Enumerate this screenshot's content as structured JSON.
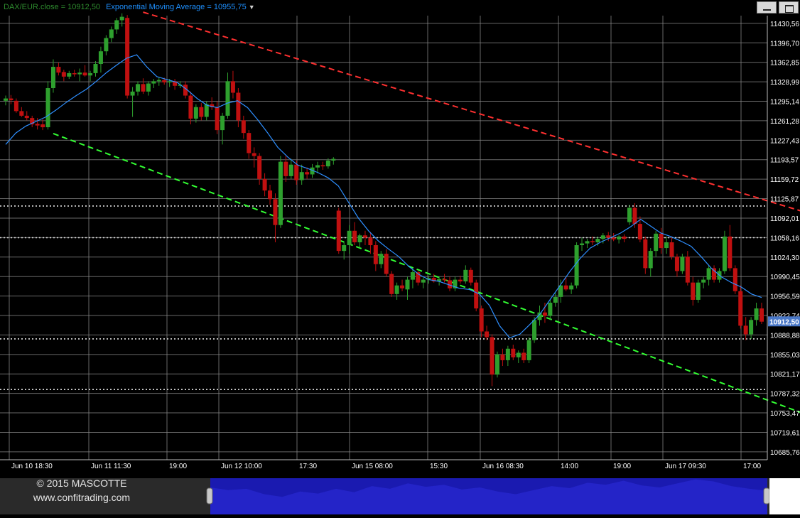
{
  "legend": {
    "close_label": "DAX/EUR.close = 10912,50",
    "ema_label": "Exponential Moving Average = 10955,75"
  },
  "footer": {
    "copyright": "© 2015 MASCOTTE",
    "website": "www.confitrading.com"
  },
  "colors": {
    "up_candle": "#2ea02e",
    "down_candle": "#c01010",
    "ema_line": "#2e8fff",
    "resistance_line": "#ff3030",
    "support_line": "#33ff33",
    "grid": "#8a8a8a",
    "navigator_fill": "#2424c8",
    "navigator_bg": "#1a1ab0"
  },
  "chart_data": {
    "type": "candlestick",
    "y_ticks": [
      "11430,56",
      "11396,70",
      "11362,85",
      "11328,99",
      "11295,14",
      "11261,28",
      "11227,43",
      "11193,57",
      "11159,72",
      "11125,87",
      "11092,01",
      "11058,16",
      "11024,30",
      "10990,45",
      "10956,59",
      "10922,74",
      "10888,88",
      "10855,03",
      "10821,17",
      "10787,32",
      "10753,47",
      "10719,61",
      "10685,76"
    ],
    "y_range": [
      10672,
      11444
    ],
    "x_ticks": [
      "Jun 10 18:30",
      "Jun 11 11:30",
      "19:00",
      "Jun 12 10:00",
      "17:30",
      "Jun 15 08:00",
      "15:30",
      "Jun 16 08:30",
      "14:00",
      "19:00",
      "Jun 17 09:30",
      "17:00"
    ],
    "last_price_label": "10912,50",
    "last_price": 10912.5,
    "horizontal_levels": [
      11113,
      11058,
      10882,
      10794
    ],
    "trendlines": [
      {
        "kind": "resistance",
        "from": [
          26,
          11450
        ],
        "to": [
          178,
          11028
        ]
      },
      {
        "kind": "support",
        "from": [
          9,
          11239
        ],
        "to": [
          172,
          10680
        ]
      }
    ],
    "candles": [
      {
        "o": 11296,
        "h": 11305,
        "l": 11288,
        "c": 11300
      },
      {
        "o": 11300,
        "h": 11306,
        "l": 11290,
        "c": 11297
      },
      {
        "o": 11296,
        "h": 11300,
        "l": 11275,
        "c": 11278
      },
      {
        "o": 11278,
        "h": 11285,
        "l": 11268,
        "c": 11270
      },
      {
        "o": 11270,
        "h": 11278,
        "l": 11262,
        "c": 11266
      },
      {
        "o": 11266,
        "h": 11270,
        "l": 11250,
        "c": 11255
      },
      {
        "o": 11256,
        "h": 11266,
        "l": 11246,
        "c": 11253
      },
      {
        "o": 11255,
        "h": 11264,
        "l": 11245,
        "c": 11250
      },
      {
        "o": 11250,
        "h": 11330,
        "l": 11246,
        "c": 11318
      },
      {
        "o": 11318,
        "h": 11368,
        "l": 11310,
        "c": 11355
      },
      {
        "o": 11355,
        "h": 11362,
        "l": 11340,
        "c": 11345
      },
      {
        "o": 11346,
        "h": 11350,
        "l": 11330,
        "c": 11338
      },
      {
        "o": 11338,
        "h": 11348,
        "l": 11334,
        "c": 11344
      },
      {
        "o": 11344,
        "h": 11350,
        "l": 11338,
        "c": 11342
      },
      {
        "o": 11342,
        "h": 11352,
        "l": 11330,
        "c": 11345
      },
      {
        "o": 11345,
        "h": 11358,
        "l": 11338,
        "c": 11340
      },
      {
        "o": 11340,
        "h": 11348,
        "l": 11330,
        "c": 11344
      },
      {
        "o": 11344,
        "h": 11365,
        "l": 11338,
        "c": 11360
      },
      {
        "o": 11360,
        "h": 11390,
        "l": 11345,
        "c": 11382
      },
      {
        "o": 11382,
        "h": 11410,
        "l": 11375,
        "c": 11405
      },
      {
        "o": 11405,
        "h": 11425,
        "l": 11398,
        "c": 11420
      },
      {
        "o": 11420,
        "h": 11440,
        "l": 11412,
        "c": 11436
      },
      {
        "o": 11436,
        "h": 11448,
        "l": 11425,
        "c": 11442
      },
      {
        "o": 11440,
        "h": 11445,
        "l": 11300,
        "c": 11305
      },
      {
        "o": 11305,
        "h": 11320,
        "l": 11268,
        "c": 11312
      },
      {
        "o": 11312,
        "h": 11330,
        "l": 11305,
        "c": 11325
      },
      {
        "o": 11325,
        "h": 11335,
        "l": 11308,
        "c": 11312
      },
      {
        "o": 11312,
        "h": 11330,
        "l": 11305,
        "c": 11326
      },
      {
        "o": 11326,
        "h": 11334,
        "l": 11318,
        "c": 11330
      },
      {
        "o": 11330,
        "h": 11336,
        "l": 11322,
        "c": 11332
      },
      {
        "o": 11332,
        "h": 11336,
        "l": 11324,
        "c": 11328
      },
      {
        "o": 11328,
        "h": 11334,
        "l": 11320,
        "c": 11330
      },
      {
        "o": 11330,
        "h": 11334,
        "l": 11315,
        "c": 11322
      },
      {
        "o": 11322,
        "h": 11330,
        "l": 11318,
        "c": 11324
      },
      {
        "o": 11324,
        "h": 11330,
        "l": 11300,
        "c": 11305
      },
      {
        "o": 11305,
        "h": 11312,
        "l": 11255,
        "c": 11265
      },
      {
        "o": 11265,
        "h": 11290,
        "l": 11258,
        "c": 11285
      },
      {
        "o": 11285,
        "h": 11292,
        "l": 11262,
        "c": 11268
      },
      {
        "o": 11268,
        "h": 11295,
        "l": 11262,
        "c": 11290
      },
      {
        "o": 11290,
        "h": 11302,
        "l": 11280,
        "c": 11285
      },
      {
        "o": 11285,
        "h": 11295,
        "l": 11238,
        "c": 11245
      },
      {
        "o": 11245,
        "h": 11275,
        "l": 11220,
        "c": 11270
      },
      {
        "o": 11270,
        "h": 11345,
        "l": 11265,
        "c": 11330
      },
      {
        "o": 11330,
        "h": 11348,
        "l": 11300,
        "c": 11310
      },
      {
        "o": 11310,
        "h": 11318,
        "l": 11250,
        "c": 11262
      },
      {
        "o": 11262,
        "h": 11270,
        "l": 11230,
        "c": 11240
      },
      {
        "o": 11240,
        "h": 11245,
        "l": 11195,
        "c": 11205
      },
      {
        "o": 11205,
        "h": 11215,
        "l": 11180,
        "c": 11200
      },
      {
        "o": 11200,
        "h": 11205,
        "l": 11150,
        "c": 11160
      },
      {
        "o": 11160,
        "h": 11170,
        "l": 11130,
        "c": 11140
      },
      {
        "o": 11140,
        "h": 11150,
        "l": 11115,
        "c": 11125
      },
      {
        "o": 11125,
        "h": 11135,
        "l": 11050,
        "c": 11080
      },
      {
        "o": 11080,
        "h": 11200,
        "l": 11075,
        "c": 11190
      },
      {
        "o": 11190,
        "h": 11200,
        "l": 11155,
        "c": 11165
      },
      {
        "o": 11165,
        "h": 11195,
        "l": 11160,
        "c": 11185
      },
      {
        "o": 11185,
        "h": 11192,
        "l": 11150,
        "c": 11158
      },
      {
        "o": 11158,
        "h": 11185,
        "l": 11150,
        "c": 11172
      },
      {
        "o": 11172,
        "h": 11180,
        "l": 11160,
        "c": 11168
      },
      {
        "o": 11168,
        "h": 11186,
        "l": 11162,
        "c": 11180
      },
      {
        "o": 11180,
        "h": 11190,
        "l": 11170,
        "c": 11184
      },
      {
        "o": 11184,
        "h": 11190,
        "l": 11176,
        "c": 11182
      },
      {
        "o": 11182,
        "h": 11196,
        "l": 11178,
        "c": 11192
      },
      {
        "o": 11192,
        "h": 11198,
        "l": 11185,
        "c": 11195
      },
      {
        "o": 11105,
        "h": 11110,
        "l": 11030,
        "c": 11035
      },
      {
        "o": 11035,
        "h": 11050,
        "l": 11020,
        "c": 11045
      },
      {
        "o": 11045,
        "h": 11080,
        "l": 11030,
        "c": 11070
      },
      {
        "o": 11070,
        "h": 11085,
        "l": 11045,
        "c": 11050
      },
      {
        "o": 11050,
        "h": 11065,
        "l": 11040,
        "c": 11062
      },
      {
        "o": 11062,
        "h": 11070,
        "l": 11045,
        "c": 11058
      },
      {
        "o": 11058,
        "h": 11068,
        "l": 11030,
        "c": 11045
      },
      {
        "o": 11045,
        "h": 11052,
        "l": 11000,
        "c": 11012
      },
      {
        "o": 11012,
        "h": 11035,
        "l": 11005,
        "c": 11030
      },
      {
        "o": 11030,
        "h": 11038,
        "l": 10990,
        "c": 10995
      },
      {
        "o": 10995,
        "h": 11000,
        "l": 10955,
        "c": 10960
      },
      {
        "o": 10960,
        "h": 10980,
        "l": 10950,
        "c": 10975
      },
      {
        "o": 10975,
        "h": 10985,
        "l": 10965,
        "c": 10970
      },
      {
        "o": 10968,
        "h": 10990,
        "l": 10950,
        "c": 10985
      },
      {
        "o": 10985,
        "h": 11005,
        "l": 10970,
        "c": 10998
      },
      {
        "o": 10998,
        "h": 11000,
        "l": 10975,
        "c": 10980
      },
      {
        "o": 10980,
        "h": 10990,
        "l": 10970,
        "c": 10985
      },
      {
        "o": 10985,
        "h": 10992,
        "l": 10978,
        "c": 10988
      },
      {
        "o": 10988,
        "h": 10995,
        "l": 10980,
        "c": 10982
      },
      {
        "o": 10982,
        "h": 10990,
        "l": 10975,
        "c": 10986
      },
      {
        "o": 10986,
        "h": 10995,
        "l": 10980,
        "c": 10984
      },
      {
        "o": 10984,
        "h": 10990,
        "l": 10965,
        "c": 10970
      },
      {
        "o": 10970,
        "h": 10990,
        "l": 10965,
        "c": 10985
      },
      {
        "o": 10985,
        "h": 10992,
        "l": 10978,
        "c": 10982
      },
      {
        "o": 10982,
        "h": 11010,
        "l": 10978,
        "c": 11002
      },
      {
        "o": 11002,
        "h": 11006,
        "l": 10975,
        "c": 10980
      },
      {
        "o": 10980,
        "h": 10985,
        "l": 10930,
        "c": 10935
      },
      {
        "o": 10935,
        "h": 10940,
        "l": 10885,
        "c": 10895
      },
      {
        "o": 10895,
        "h": 10905,
        "l": 10880,
        "c": 10885
      },
      {
        "o": 10885,
        "h": 10890,
        "l": 10800,
        "c": 10820
      },
      {
        "o": 10820,
        "h": 10860,
        "l": 10815,
        "c": 10855
      },
      {
        "o": 10855,
        "h": 10865,
        "l": 10835,
        "c": 10845
      },
      {
        "o": 10845,
        "h": 10870,
        "l": 10835,
        "c": 10865
      },
      {
        "o": 10865,
        "h": 10872,
        "l": 10845,
        "c": 10850
      },
      {
        "o": 10850,
        "h": 10862,
        "l": 10840,
        "c": 10858
      },
      {
        "o": 10858,
        "h": 10865,
        "l": 10840,
        "c": 10845
      },
      {
        "o": 10845,
        "h": 10885,
        "l": 10840,
        "c": 10880
      },
      {
        "o": 10880,
        "h": 10920,
        "l": 10875,
        "c": 10915
      },
      {
        "o": 10915,
        "h": 10940,
        "l": 10905,
        "c": 10928
      },
      {
        "o": 10928,
        "h": 10945,
        "l": 10910,
        "c": 10922
      },
      {
        "o": 10922,
        "h": 10950,
        "l": 10915,
        "c": 10945
      },
      {
        "o": 10945,
        "h": 10962,
        "l": 10938,
        "c": 10955
      },
      {
        "o": 10955,
        "h": 10985,
        "l": 10945,
        "c": 10975
      },
      {
        "o": 10975,
        "h": 10990,
        "l": 10965,
        "c": 10968
      },
      {
        "o": 10968,
        "h": 10980,
        "l": 10960,
        "c": 10975
      },
      {
        "o": 10975,
        "h": 11050,
        "l": 10970,
        "c": 11045
      },
      {
        "o": 11045,
        "h": 11058,
        "l": 11035,
        "c": 11048
      },
      {
        "o": 11048,
        "h": 11056,
        "l": 11040,
        "c": 11052
      },
      {
        "o": 11052,
        "h": 11060,
        "l": 11045,
        "c": 11050
      },
      {
        "o": 11050,
        "h": 11060,
        "l": 11044,
        "c": 11056
      },
      {
        "o": 11056,
        "h": 11066,
        "l": 11048,
        "c": 11062
      },
      {
        "o": 11062,
        "h": 11068,
        "l": 11052,
        "c": 11058
      },
      {
        "o": 11058,
        "h": 11066,
        "l": 11052,
        "c": 11055
      },
      {
        "o": 11055,
        "h": 11062,
        "l": 11048,
        "c": 11060
      },
      {
        "o": 11060,
        "h": 11064,
        "l": 11050,
        "c": 11056
      },
      {
        "o": 11085,
        "h": 11115,
        "l": 11080,
        "c": 11110
      },
      {
        "o": 11110,
        "h": 11118,
        "l": 11075,
        "c": 11082
      },
      {
        "o": 11082,
        "h": 11095,
        "l": 11050,
        "c": 11055
      },
      {
        "o": 11055,
        "h": 11060,
        "l": 10995,
        "c": 11005
      },
      {
        "o": 11005,
        "h": 11040,
        "l": 10990,
        "c": 11035
      },
      {
        "o": 11035,
        "h": 11070,
        "l": 11025,
        "c": 11065
      },
      {
        "o": 11065,
        "h": 11075,
        "l": 11030,
        "c": 11040
      },
      {
        "o": 11040,
        "h": 11060,
        "l": 11030,
        "c": 11050
      },
      {
        "o": 11050,
        "h": 11060,
        "l": 11020,
        "c": 11025
      },
      {
        "o": 11025,
        "h": 11030,
        "l": 10990,
        "c": 11000
      },
      {
        "o": 11000,
        "h": 11030,
        "l": 10995,
        "c": 11025
      },
      {
        "o": 11025,
        "h": 11035,
        "l": 10975,
        "c": 10980
      },
      {
        "o": 10980,
        "h": 10990,
        "l": 10940,
        "c": 10950
      },
      {
        "o": 10950,
        "h": 10985,
        "l": 10945,
        "c": 10980
      },
      {
        "o": 10980,
        "h": 10990,
        "l": 10970,
        "c": 10985
      },
      {
        "o": 10985,
        "h": 11010,
        "l": 10975,
        "c": 11005
      },
      {
        "o": 11005,
        "h": 11010,
        "l": 10980,
        "c": 10985
      },
      {
        "o": 10985,
        "h": 11005,
        "l": 10980,
        "c": 11000
      },
      {
        "o": 11000,
        "h": 11070,
        "l": 10995,
        "c": 11060
      },
      {
        "o": 11060,
        "h": 11080,
        "l": 11000,
        "c": 11005
      },
      {
        "o": 11005,
        "h": 11010,
        "l": 10960,
        "c": 10965
      },
      {
        "o": 10965,
        "h": 10975,
        "l": 10900,
        "c": 10905
      },
      {
        "o": 10905,
        "h": 10920,
        "l": 10880,
        "c": 10890
      },
      {
        "o": 10890,
        "h": 10920,
        "l": 10882,
        "c": 10915
      },
      {
        "o": 10915,
        "h": 10945,
        "l": 10905,
        "c": 10935
      },
      {
        "o": 10935,
        "h": 10945,
        "l": 10908,
        "c": 10912
      }
    ],
    "ema": [
      11220,
      11240,
      11252,
      11260,
      11268,
      11280,
      11293,
      11305,
      11316,
      11330,
      11345,
      11358,
      11370,
      11376,
      11355,
      11338,
      11333,
      11328,
      11315,
      11300,
      11288,
      11284,
      11292,
      11296,
      11284,
      11263,
      11240,
      11215,
      11198,
      11184,
      11178,
      11171,
      11162,
      11148,
      11120,
      11092,
      11070,
      11052,
      11038,
      11025,
      11008,
      10994,
      10985,
      10982,
      10976,
      10970,
      10968,
      10960,
      10940,
      10905,
      10884,
      10890,
      10907,
      10925,
      10950,
      10975,
      11000,
      11022,
      11040,
      11050,
      11058,
      11066,
      11077,
      11090,
      11078,
      11066,
      11060,
      11052,
      11043,
      11025,
      11005,
      10990,
      10980,
      10972,
      10960,
      10954
    ],
    "navigator_profile": [
      40,
      36,
      38,
      30,
      26,
      34,
      31,
      38,
      33,
      42,
      38,
      46,
      41,
      44,
      37,
      40,
      34,
      30,
      36,
      42,
      39,
      47,
      44,
      50,
      43,
      40,
      46,
      52,
      49,
      42,
      38,
      35
    ]
  }
}
